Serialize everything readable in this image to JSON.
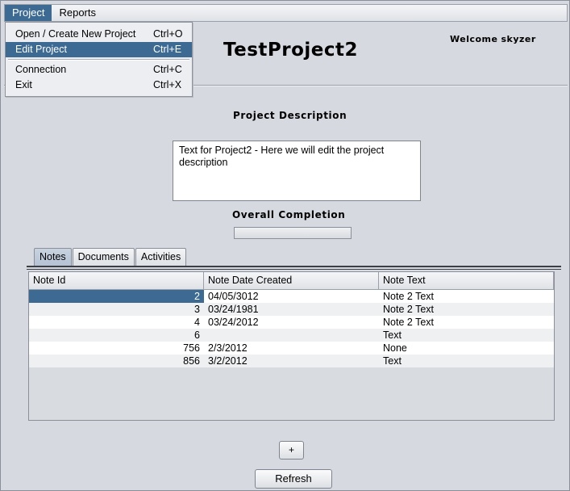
{
  "menubar": {
    "items": [
      {
        "label": "Project",
        "active": true
      },
      {
        "label": "Reports",
        "active": false
      }
    ]
  },
  "project_menu": {
    "items": [
      {
        "label": "Open / Create New Project",
        "accelerator": "Ctrl+O"
      },
      {
        "label": "Edit Project",
        "accelerator": "Ctrl+E"
      },
      {
        "label": "Connection",
        "accelerator": "Ctrl+C"
      },
      {
        "label": "Exit",
        "accelerator": "Ctrl+X"
      }
    ]
  },
  "header": {
    "project_title": "TestProject2",
    "welcome_prefix": "Welcome",
    "username": "skyzer"
  },
  "description": {
    "label": "Project Description",
    "text": "Text for Project2 - Here we will edit the project description"
  },
  "completion": {
    "label": "Overall Completion",
    "percent": 0
  },
  "tabs": [
    {
      "label": "Notes",
      "active": true
    },
    {
      "label": "Documents",
      "active": false
    },
    {
      "label": "Activities",
      "active": false
    }
  ],
  "notes_table": {
    "columns": [
      "Note Id",
      "Note Date Created",
      "Note Text"
    ],
    "rows": [
      [
        "2",
        "04/05/3012",
        "Note 2 Text"
      ],
      [
        "3",
        "03/24/1981",
        "Note 2 Text"
      ],
      [
        "4",
        "03/24/2012",
        "Note 2 Text"
      ],
      [
        "6",
        "",
        "Text"
      ],
      [
        "756",
        "2/3/2012",
        "None"
      ],
      [
        "856",
        "3/2/2012",
        "Text"
      ]
    ]
  },
  "buttons": {
    "add_label": "+",
    "refresh_label": "Refresh"
  },
  "colors": {
    "selection": "#3d6a93",
    "background": "#d6d9df"
  }
}
